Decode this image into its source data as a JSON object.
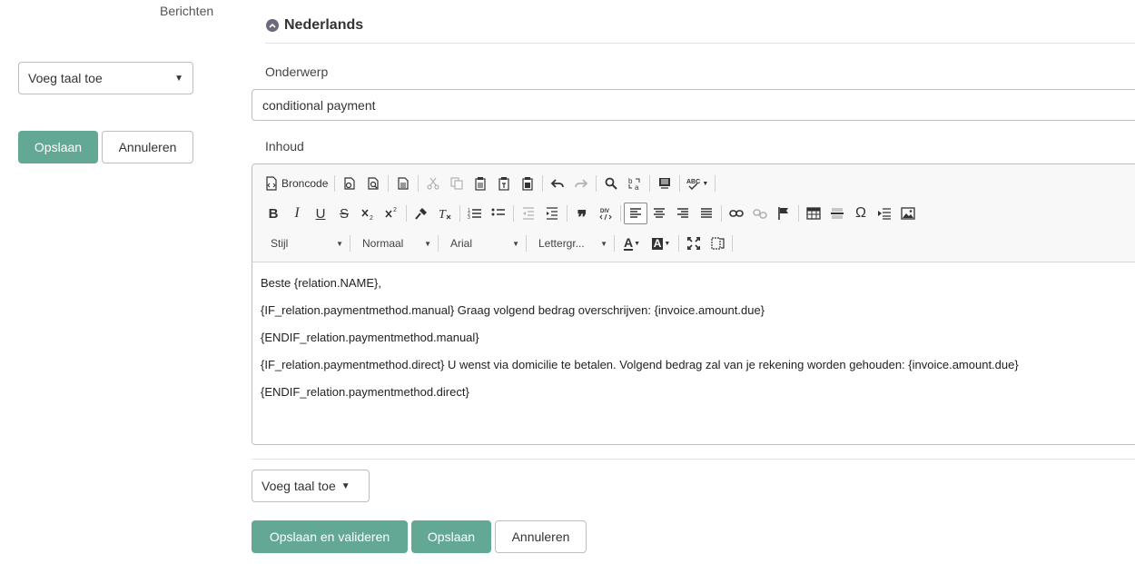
{
  "breadcrumb": "Berichten",
  "left_panel": {
    "add_language_label": "Voeg taal toe",
    "save_label": "Opslaan",
    "cancel_label": "Annuleren"
  },
  "section": {
    "title": "Nederlands"
  },
  "subject": {
    "label": "Onderwerp",
    "value": "conditional payment"
  },
  "content": {
    "label": "Inhoud",
    "toolbar": {
      "source_label": "Broncode",
      "style_combo": "Stijl",
      "format_combo": "Normaal",
      "font_combo": "Arial",
      "size_combo": "Lettergr...",
      "text_color_glyph": "A",
      "bg_color_glyph": "A",
      "bold": "B",
      "italic": "I",
      "underline": "U",
      "strike": "S",
      "omega": "Ω"
    },
    "body_lines": [
      "Beste {relation.NAME},",
      "{IF_relation.paymentmethod.manual} Graag volgend bedrag overschrijven: {invoice.amount.due}",
      "{ENDIF_relation.paymentmethod.manual}",
      "{IF_relation.paymentmethod.direct} U wenst via domicilie te betalen. Volgend bedrag zal van je rekening worden gehouden: {invoice.amount.due}",
      "{ENDIF_relation.paymentmethod.direct}"
    ]
  },
  "footer": {
    "add_language_label": "Voeg taal toe",
    "save_validate_label": "Opslaan en valideren",
    "save_label": "Opslaan",
    "cancel_label": "Annuleren"
  },
  "colors": {
    "primary": "#62a894",
    "border": "#bdbdbd",
    "toolbar_bg": "#f8f8f8"
  }
}
